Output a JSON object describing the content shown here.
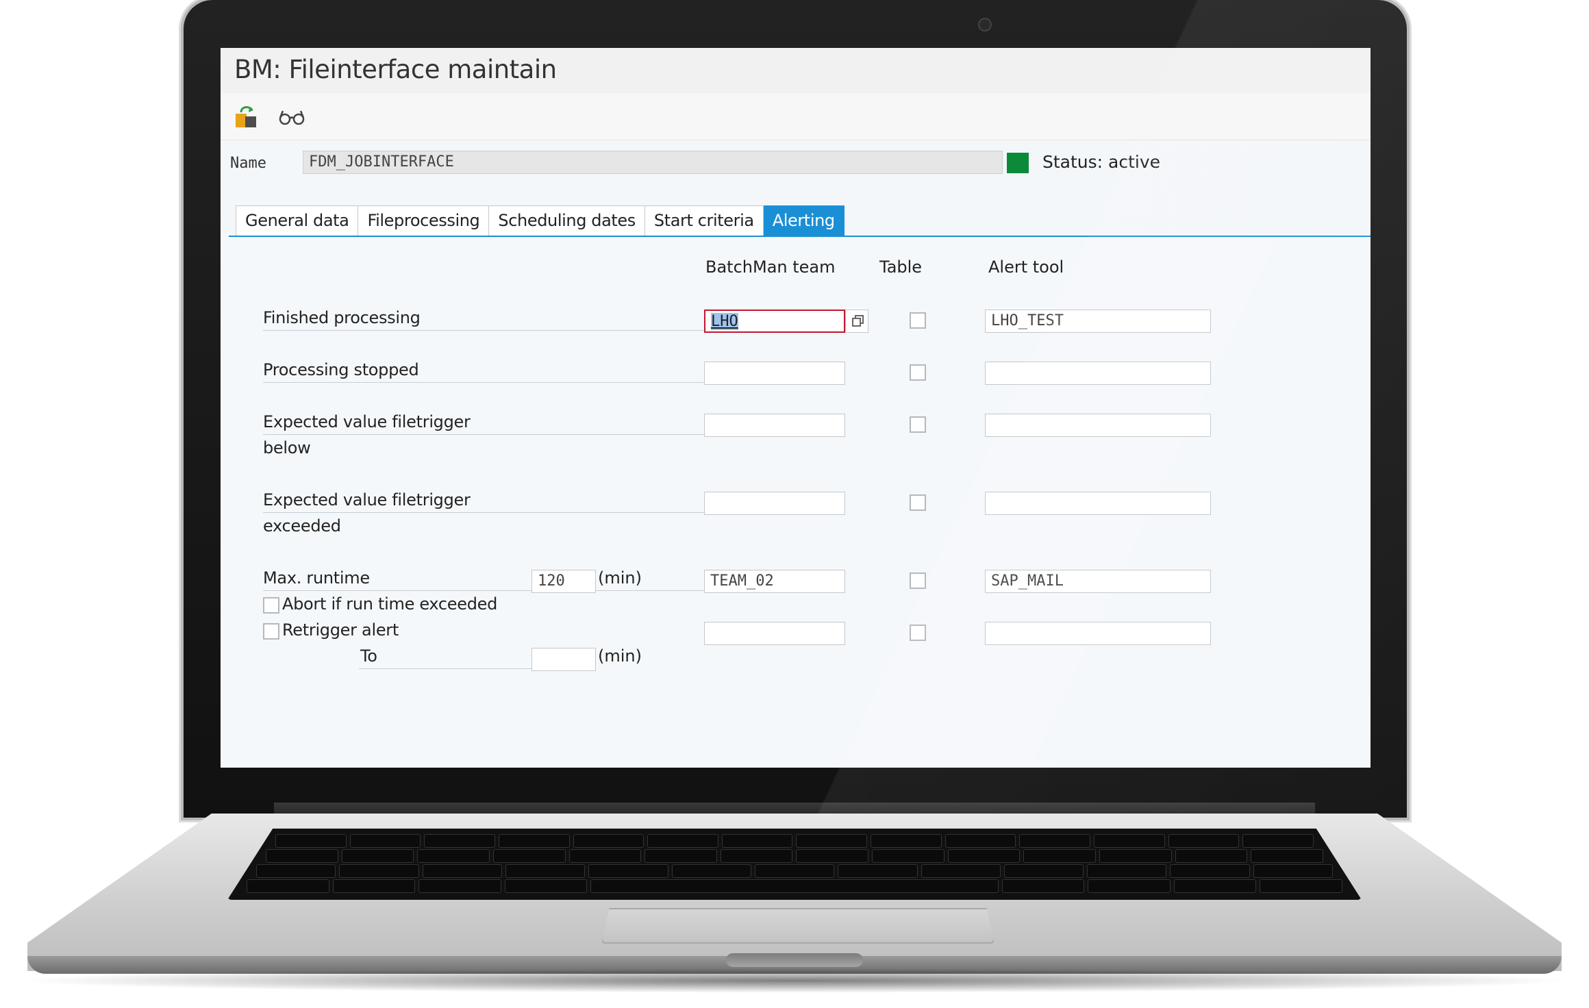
{
  "window": {
    "title": "BM: Fileinterface maintain"
  },
  "toolbar": {
    "items": [
      {
        "icon": "transport-icon"
      },
      {
        "icon": "display-glasses-icon"
      }
    ]
  },
  "header": {
    "name_label": "Name",
    "name_value": "FDM_JOBINTERFACE",
    "status_color": "#0c8a3a",
    "status_text": "Status: active"
  },
  "tabs": [
    {
      "label": "General data",
      "active": false
    },
    {
      "label": "Fileprocessing",
      "active": false
    },
    {
      "label": "Scheduling dates",
      "active": false
    },
    {
      "label": "Start criteria",
      "active": false
    },
    {
      "label": "Alerting",
      "active": true
    }
  ],
  "columns": {
    "team": "BatchMan team",
    "table": "Table",
    "tool": "Alert tool"
  },
  "rows": [
    {
      "label": "Finished processing",
      "team": "LHO",
      "table_checked": false,
      "tool": "LHO_TEST"
    },
    {
      "label": "Processing stopped",
      "team": "",
      "table_checked": false,
      "tool": ""
    },
    {
      "label": "Expected value filetrigger",
      "label2": "below",
      "team": "",
      "table_checked": false,
      "tool": ""
    },
    {
      "label": "Expected value filetrigger",
      "label2": "exceeded",
      "team": "",
      "table_checked": false,
      "tool": ""
    },
    {
      "label": "Max. runtime",
      "runtime_value": "120",
      "unit": "(min)",
      "team": "TEAM_02",
      "table_checked": false,
      "tool": "SAP_MAIL"
    }
  ],
  "options": {
    "abort_label": "Abort if run time exceeded",
    "abort_checked": false,
    "retrigger_label": "Retrigger alert",
    "retrigger_checked": false,
    "retrigger_team": "",
    "retrigger_table_checked": false,
    "retrigger_tool": "",
    "to_label": "To",
    "to_value": "",
    "to_unit": "(min)"
  },
  "colors": {
    "accent": "#1b8fd6",
    "focus_border": "#c01830",
    "status_active": "#0c8a3a"
  }
}
